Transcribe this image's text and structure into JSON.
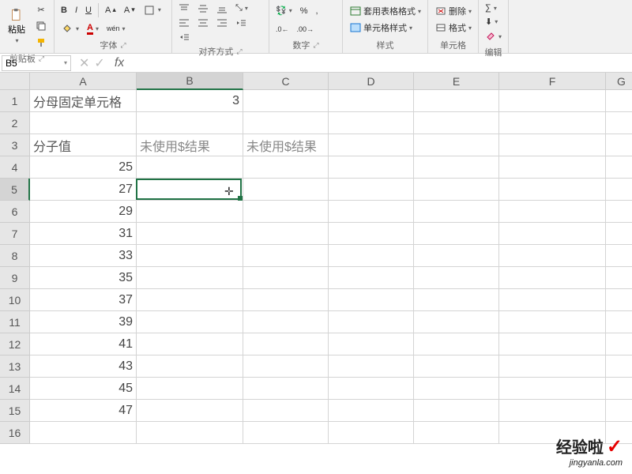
{
  "ribbon": {
    "clipboard": {
      "paste": "粘贴",
      "label": "剪贴板"
    },
    "font": {
      "bold": "B",
      "italic": "I",
      "underline": "U",
      "label": "字体"
    },
    "alignment": {
      "label": "对齐方式"
    },
    "number": {
      "percent": "%",
      "comma": ",",
      "label": "数字"
    },
    "styles": {
      "table_format": "套用表格格式",
      "cell_style": "单元格样式",
      "label": "样式"
    },
    "cells": {
      "delete": "删除",
      "format": "格式",
      "label": "单元格"
    },
    "editing": {
      "label": "编辑"
    }
  },
  "namebox": {
    "value": "B5"
  },
  "formula": {
    "value": ""
  },
  "columns": [
    "A",
    "B",
    "C",
    "D",
    "E",
    "F",
    "G"
  ],
  "rows": [
    "1",
    "2",
    "3",
    "4",
    "5",
    "6",
    "7",
    "8",
    "9",
    "10",
    "11",
    "12",
    "13",
    "14",
    "15",
    "16"
  ],
  "cells": {
    "A1": "分母固定单元格",
    "B1": "3",
    "A3": "分子值",
    "B3": "未使用$结果",
    "C3": "未使用$结果",
    "A4": "25",
    "A5": "27",
    "A6": "29",
    "A7": "31",
    "A8": "33",
    "A9": "35",
    "A10": "37",
    "A11": "39",
    "A12": "41",
    "A13": "43",
    "A14": "45",
    "A15": "47"
  },
  "selection": {
    "cell": "B5"
  },
  "watermark": {
    "text": "经验啦",
    "url": "jingyanla.com"
  }
}
